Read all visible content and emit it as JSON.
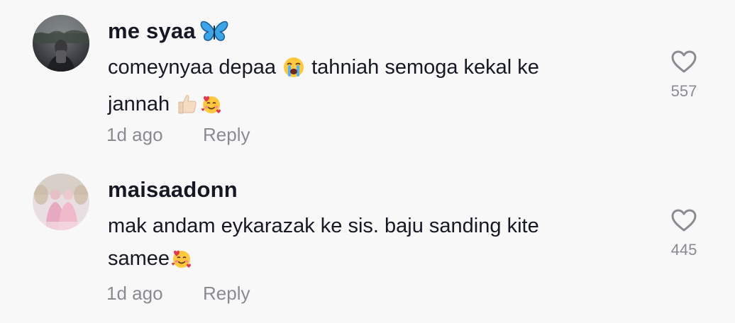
{
  "comments": [
    {
      "username": "me syaa",
      "username_emoji": "butterfly-emoji",
      "text_parts": [
        "comeynyaa depaa",
        "tahniah semoga kekal ke",
        "jannah"
      ],
      "text_emojis": [
        "loudly-crying-face-emoji",
        "thumbs-up-emoji",
        "smiling-face-with-hearts-emoji"
      ],
      "time": "1d ago",
      "reply_label": "Reply",
      "like_icon": "heart-outline-icon",
      "like_count": "557"
    },
    {
      "username": "maisaadonn",
      "text_parts": [
        "mak andam eykarazak ke sis. baju sanding kite",
        "samee"
      ],
      "text_emojis": [
        "smiling-face-with-hearts-emoji"
      ],
      "time": "1d ago",
      "reply_label": "Reply",
      "like_icon": "heart-outline-icon",
      "like_count": "445"
    }
  ],
  "colors": {
    "background": "#f8f8f8",
    "text_primary": "#161823",
    "text_secondary": "#8a8b91"
  }
}
